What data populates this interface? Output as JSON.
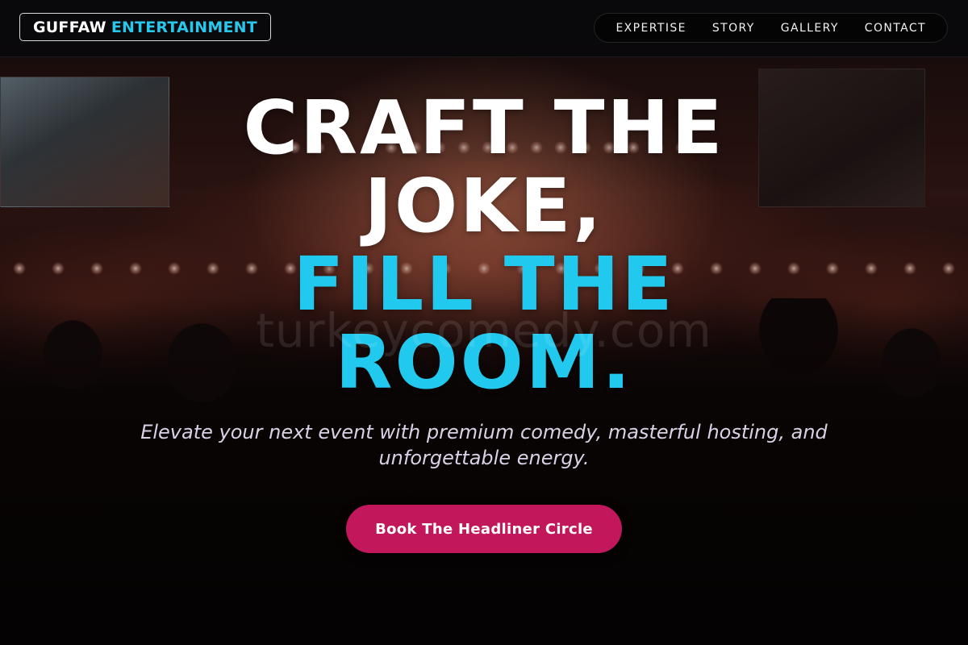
{
  "brand": {
    "name_primary": "GUFFAW",
    "name_accent": "ENTERTAINMENT",
    "accent_color": "#27c8ec"
  },
  "nav": {
    "items": [
      {
        "label": "EXPERTISE"
      },
      {
        "label": "STORY"
      },
      {
        "label": "GALLERY"
      },
      {
        "label": "CONTACT"
      }
    ]
  },
  "hero": {
    "headline_line1": "CRAFT THE",
    "headline_line2": "JOKE,",
    "headline_line3": "FILL THE",
    "headline_line4": "ROOM.",
    "watermark": "turkeycomedy.com",
    "subtitle": "Elevate your next event with premium comedy, masterful hosting, and unforgettable energy.",
    "cta_label": "Book The Headliner Circle",
    "cta_color": "#c2185b",
    "background_image": "concert-crowd-photo"
  }
}
